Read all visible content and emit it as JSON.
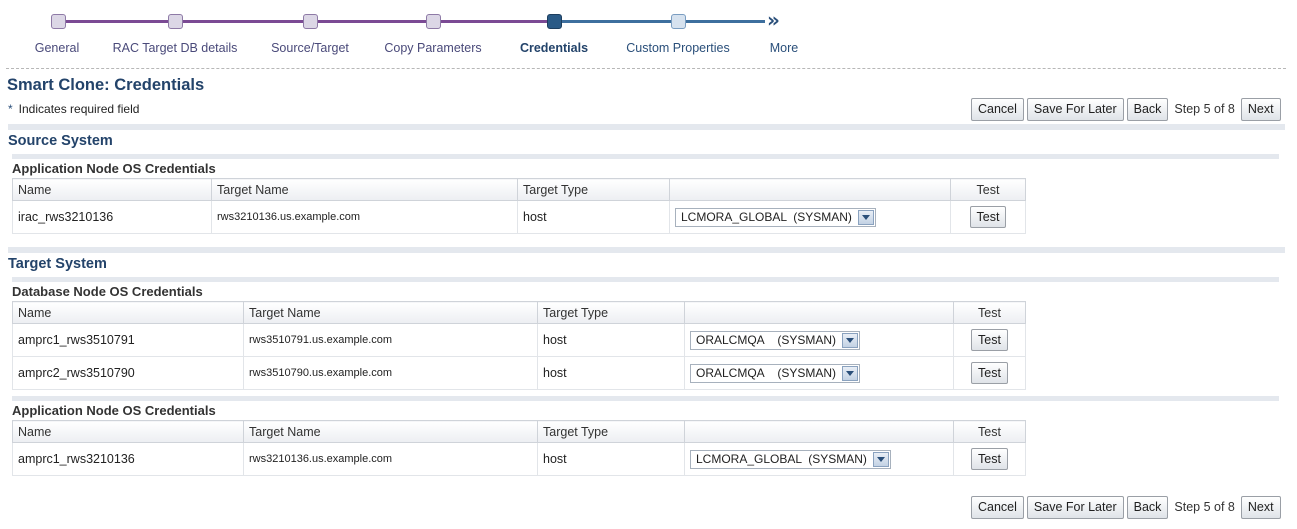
{
  "train": {
    "steps": [
      {
        "label": "General",
        "state": "visited"
      },
      {
        "label": "RAC Target DB details",
        "state": "visited"
      },
      {
        "label": "Source/Target",
        "state": "visited"
      },
      {
        "label": "Copy Parameters",
        "state": "visited"
      },
      {
        "label": "Credentials",
        "state": "current"
      },
      {
        "label": "Custom Properties",
        "state": "future"
      }
    ],
    "more_label": "More",
    "more_icon": "double-chevron-right-icon"
  },
  "page": {
    "title": "Smart Clone: Credentials",
    "required_star": "*",
    "required_note": "Indicates required field"
  },
  "buttons": {
    "cancel": "Cancel",
    "save_later": "Save For Later",
    "back": "Back",
    "step": "Step 5 of 8",
    "next": "Next"
  },
  "source": {
    "title": "Source System",
    "app_node": {
      "title": "Application Node OS Credentials",
      "headers": {
        "name": "Name",
        "target_name": "Target Name",
        "target_type": "Target Type",
        "credential": "",
        "test": "Test"
      },
      "rows": [
        {
          "name": "irac_rws3210136",
          "target_name": "rws3210136.us.example.com",
          "target_type": "host",
          "credential": "LCMORA_GLOBAL  (SYSMAN)",
          "test": "Test"
        }
      ]
    }
  },
  "target": {
    "title": "Target System",
    "db_node": {
      "title": "Database Node OS Credentials",
      "headers": {
        "name": "Name",
        "target_name": "Target Name",
        "target_type": "Target Type",
        "credential": "",
        "test": "Test"
      },
      "rows": [
        {
          "name": "amprc1_rws3510791",
          "target_name": "rws3510791.us.example.com",
          "target_type": "host",
          "credential": "ORALCMQA    (SYSMAN)",
          "test": "Test"
        },
        {
          "name": "amprc2_rws3510790",
          "target_name": "rws3510790.us.example.com",
          "target_type": "host",
          "credential": "ORALCMQA    (SYSMAN)",
          "test": "Test"
        }
      ]
    },
    "app_node": {
      "title": "Application Node OS Credentials",
      "headers": {
        "name": "Name",
        "target_name": "Target Name",
        "target_type": "Target Type",
        "credential": "",
        "test": "Test"
      },
      "rows": [
        {
          "name": "amprc1_rws3210136",
          "target_name": "rws3210136.us.example.com",
          "target_type": "host",
          "credential": "LCMORA_GLOBAL  (SYSMAN)",
          "test": "Test"
        }
      ]
    }
  },
  "colors": {
    "title_blue": "#23436a",
    "visited_track": "#7b4a94",
    "future_track": "#3d6f9e",
    "current_step": "#2a5a86"
  }
}
